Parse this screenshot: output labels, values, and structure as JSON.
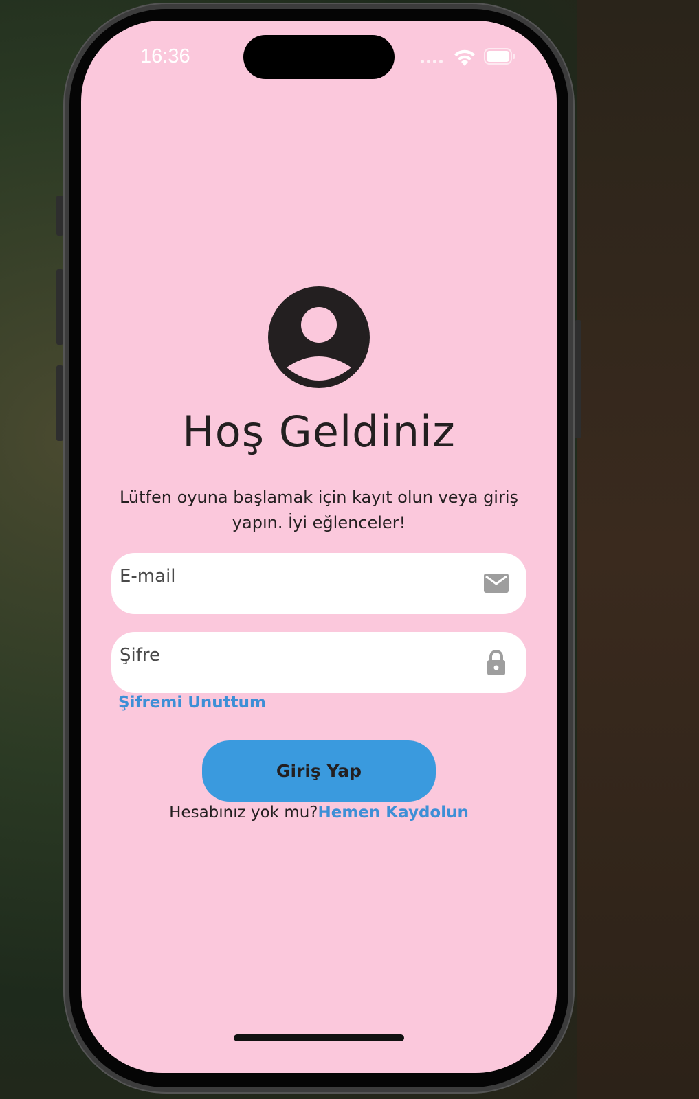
{
  "status_bar": {
    "time": "16:36"
  },
  "icons": {
    "avatar": "account-circle-icon",
    "email": "mail-icon",
    "password": "lock-icon",
    "wifi": "wifi-icon",
    "battery": "battery-icon"
  },
  "login": {
    "title": "Hoş Geldiniz",
    "subtitle": "Lütfen oyuna başlamak için kayıt olun veya giriş yapın. İyi eğlenceler!",
    "email_placeholder": "E-mail",
    "email_value": "",
    "password_placeholder": "Şifre",
    "password_value": "",
    "forgot_password": "Şifremi Unuttum",
    "login_button": "Giriş Yap",
    "no_account_text": "Hesabınız yok mu?",
    "register_link": "Hemen Kaydolun"
  },
  "colors": {
    "background": "#fbc8dc",
    "accent": "#3a9ade",
    "link": "#3d8fd6",
    "text": "#231f20"
  }
}
